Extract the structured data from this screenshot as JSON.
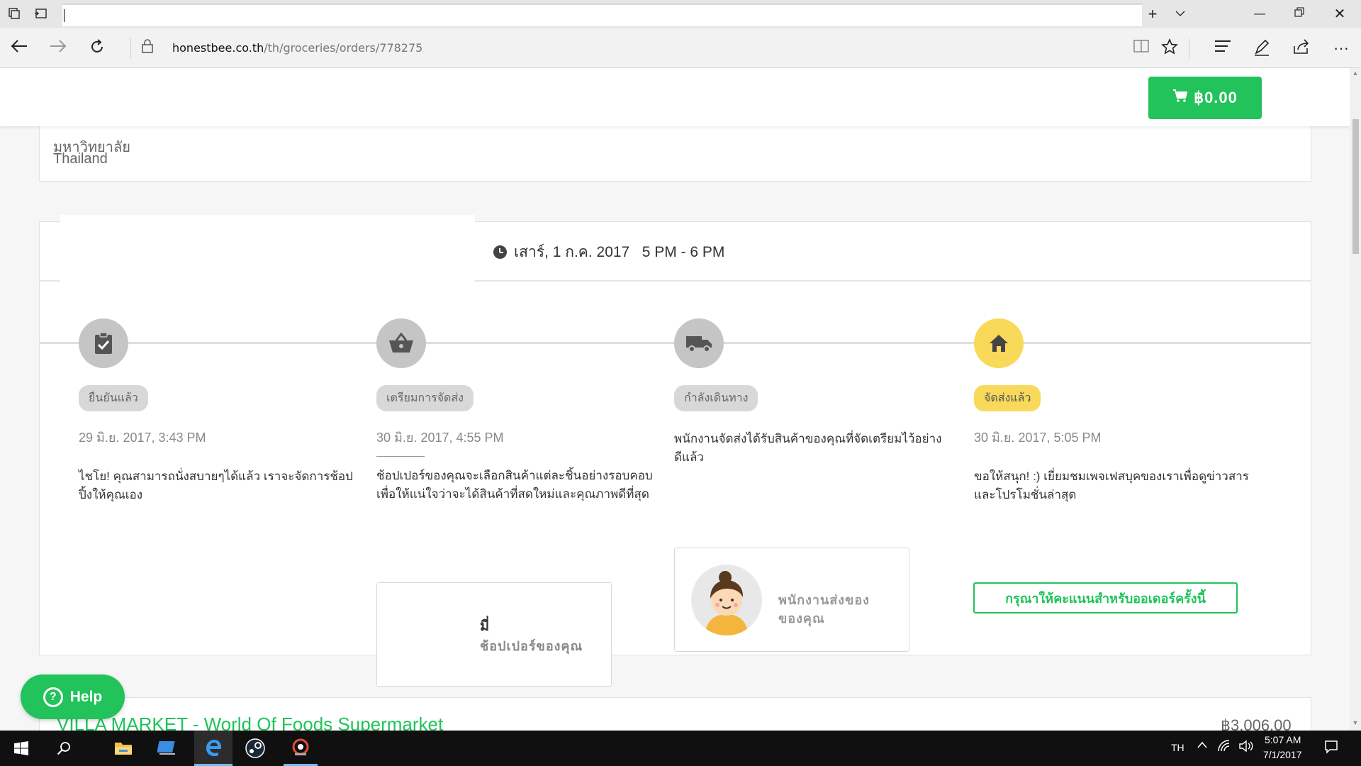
{
  "browser": {
    "url_domain": "honestbee.co.th",
    "url_path": "/th/groceries/orders/778275"
  },
  "header": {
    "cart_total": "฿0.00"
  },
  "address": {
    "line": "มหาวิทยาลัย",
    "country": "Thailand"
  },
  "delivery_slot": {
    "text": "เสาร์, 1 ก.ค. 2017   5 PM - 6 PM"
  },
  "steps": [
    {
      "badge": "ยืนยันแล้ว",
      "date": "29 มิ.ย. 2017, 3:43 PM",
      "description": "ไชโย! คุณสามารถนั่งสบายๆได้แล้ว เราจะจัดการช้อปปิ้งให้คุณเอง",
      "icon": "clipboard-check-icon"
    },
    {
      "badge": "เตรียมการจัดส่ง",
      "date": "30 มิ.ย. 2017, 4:55 PM",
      "description": "ช้อปเปอร์ของคุณจะเลือกสินค้าแต่ละชิ้นอย่างรอบคอบเพื่อให้แน่ใจว่าจะได้สินค้าที่สดใหม่และคุณภาพดีที่สุด",
      "icon": "basket-icon",
      "person_name": "มี่",
      "person_role": "ช้อปเปอร์ของคุณ"
    },
    {
      "badge": "กำลังเดินทาง",
      "date": "",
      "description": "พนักงานจัดส่งได้รับสินค้าของคุณที่จัดเตรียมไว้อย่างดีแล้ว",
      "icon": "truck-icon",
      "person_role": "พนักงานส่งของของคุณ"
    },
    {
      "badge": "จัดส่งแล้ว",
      "date": "30 มิ.ย. 2017, 5:05 PM",
      "description": "ขอให้สนุก! :) เยี่ยมชมเพจเฟสบุคของเราเพื่อดูข่าวสารและโปรโมชั่นล่าสุด",
      "icon": "home-icon"
    }
  ],
  "rate_button": "กรุณาให้คะแนนสำหรับออเดอร์ครั้งนี้",
  "store": {
    "name": "VILLA MARKET - World Of Foods Supermarket",
    "total": "฿3,006.00"
  },
  "help": {
    "label": "Help"
  },
  "taskbar": {
    "language": "TH",
    "time": "5:07 AM",
    "date": "7/1/2017"
  },
  "colors": {
    "brand_green": "#21c35a",
    "delivered_yellow": "#f9d95a",
    "pending_gray": "#c5c5c5"
  }
}
